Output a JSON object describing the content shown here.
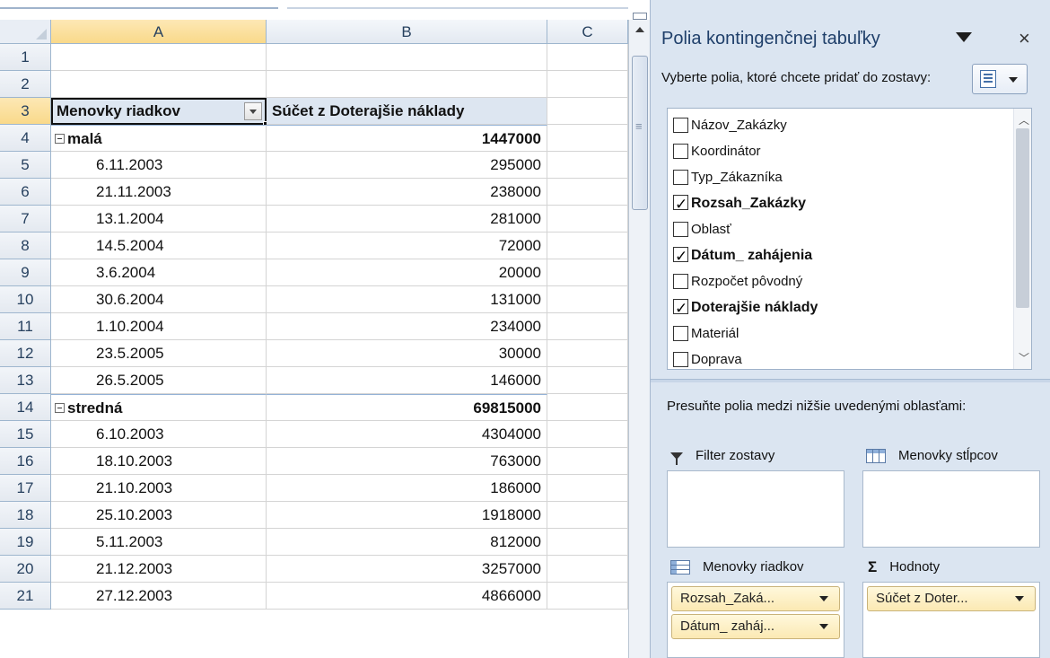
{
  "columns": [
    "A",
    "B",
    "C"
  ],
  "rows": [
    {
      "num": "1",
      "a": "",
      "b": ""
    },
    {
      "num": "2",
      "a": "",
      "b": ""
    },
    {
      "num": "3",
      "a": "Menovky riadkov",
      "b": "Súčet z Doterajšie náklady",
      "type": "header"
    },
    {
      "num": "4",
      "a": "malá",
      "b": "1447000",
      "type": "group"
    },
    {
      "num": "5",
      "a": "6.11.2003",
      "b": "295000"
    },
    {
      "num": "6",
      "a": "21.11.2003",
      "b": "238000"
    },
    {
      "num": "7",
      "a": "13.1.2004",
      "b": "281000"
    },
    {
      "num": "8",
      "a": "14.5.2004",
      "b": "72000"
    },
    {
      "num": "9",
      "a": "3.6.2004",
      "b": "20000"
    },
    {
      "num": "10",
      "a": "30.6.2004",
      "b": "131000"
    },
    {
      "num": "11",
      "a": "1.10.2004",
      "b": "234000"
    },
    {
      "num": "12",
      "a": "23.5.2005",
      "b": "30000"
    },
    {
      "num": "13",
      "a": "26.5.2005",
      "b": "146000"
    },
    {
      "num": "14",
      "a": "stredná",
      "b": "69815000",
      "type": "group"
    },
    {
      "num": "15",
      "a": "6.10.2003",
      "b": "4304000"
    },
    {
      "num": "16",
      "a": "18.10.2003",
      "b": "763000"
    },
    {
      "num": "17",
      "a": "21.10.2003",
      "b": "186000"
    },
    {
      "num": "18",
      "a": "25.10.2003",
      "b": "1918000"
    },
    {
      "num": "19",
      "a": "5.11.2003",
      "b": "812000"
    },
    {
      "num": "20",
      "a": "21.12.2003",
      "b": "3257000"
    },
    {
      "num": "21",
      "a": "27.12.2003",
      "b": "4866000"
    }
  ],
  "pane": {
    "title": "Polia kontingenčnej tabuľky",
    "choose_label": "Vyberte polia, ktoré chcete pridať do zostavy:",
    "fields": [
      {
        "label": "Názov_Zakázky",
        "checked": false
      },
      {
        "label": "Koordinátor",
        "checked": false
      },
      {
        "label": "Typ_Zákazníka",
        "checked": false
      },
      {
        "label": "Rozsah_Zakázky",
        "checked": true
      },
      {
        "label": "Oblasť",
        "checked": false
      },
      {
        "label": "Dátum_ zahájenia",
        "checked": true
      },
      {
        "label": "Rozpočet pôvodný",
        "checked": false
      },
      {
        "label": "Doterajšie náklady",
        "checked": true
      },
      {
        "label": "Materiál",
        "checked": false
      },
      {
        "label": "Doprava",
        "checked": false
      }
    ],
    "drag_label": "Presuňte polia medzi nižšie uvedenými oblasťami:",
    "areas": {
      "filter": {
        "label": "Filter zostavy",
        "chips": []
      },
      "columns": {
        "label": "Menovky stĺpcov",
        "chips": []
      },
      "rows": {
        "label": "Menovky riadkov",
        "chips": [
          "Rozsah_Zaká...",
          "Dátum_ zaháj..."
        ]
      },
      "values": {
        "label": "Hodnoty",
        "chips": [
          "Súčet z Doter..."
        ]
      }
    },
    "close_glyph": "×",
    "sigma_glyph": "Σ"
  }
}
